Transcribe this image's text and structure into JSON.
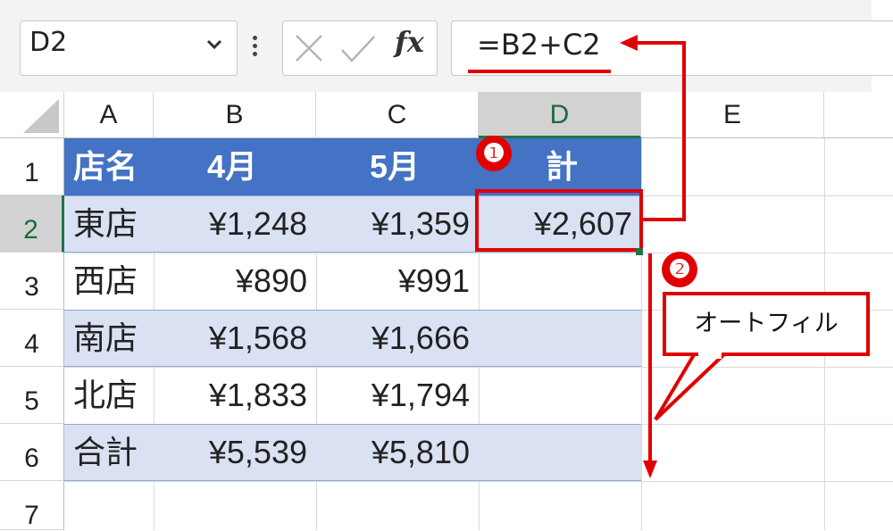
{
  "name_box": {
    "value": "D2"
  },
  "formula_bar": {
    "formula": "=B2+C2"
  },
  "columns": [
    "A",
    "B",
    "C",
    "D",
    "E"
  ],
  "rows": [
    "1",
    "2",
    "3",
    "4",
    "5",
    "6",
    "7"
  ],
  "table": {
    "header": [
      "店名",
      "4月",
      "5月",
      "計"
    ],
    "body": [
      [
        "東店",
        "¥1,248",
        "¥1,359",
        "¥2,607"
      ],
      [
        "西店",
        "¥890",
        "¥991",
        ""
      ],
      [
        "南店",
        "¥1,568",
        "¥1,666",
        ""
      ],
      [
        "北店",
        "¥1,833",
        "¥1,794",
        ""
      ],
      [
        "合計",
        "¥5,539",
        "¥5,810",
        ""
      ]
    ]
  },
  "annotations": {
    "step1_badge": "❶",
    "step2_badge": "❷",
    "callout_text": "オートフィル",
    "accent_color": "#e00000"
  },
  "colors": {
    "header_fill": "#4472c4",
    "band_fill": "#d9e1f2",
    "selection_green": "#217346"
  }
}
